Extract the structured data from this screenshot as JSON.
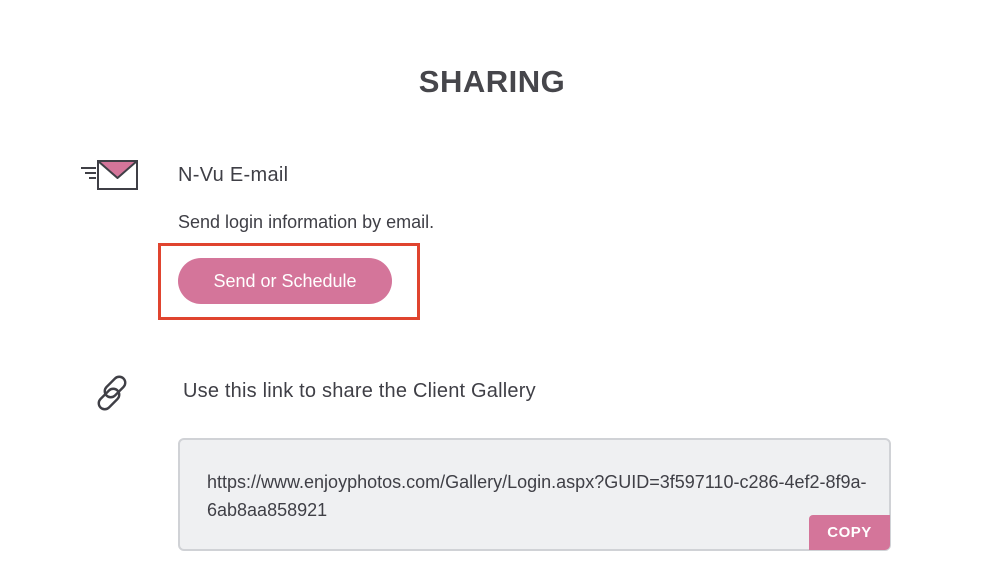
{
  "page": {
    "title": "SHARING"
  },
  "email_section": {
    "icon": "envelope-icon",
    "title": "N-Vu E-mail",
    "description": "Send login information by email.",
    "send_button_label": "Send or Schedule"
  },
  "link_section": {
    "icon": "link-icon",
    "title": "Use this link to share the Client Gallery",
    "url": "https://www.enjoyphotos.com/Gallery/Login.aspx?GUID=3f597110-c286-4ef2-8f9a-6ab8aa858921",
    "copy_button_label": "COPY"
  },
  "colors": {
    "accent": "#d4759a",
    "highlight_border": "#e0442f",
    "text": "#3f3f46",
    "link_box_bg": "#eff0f2"
  }
}
